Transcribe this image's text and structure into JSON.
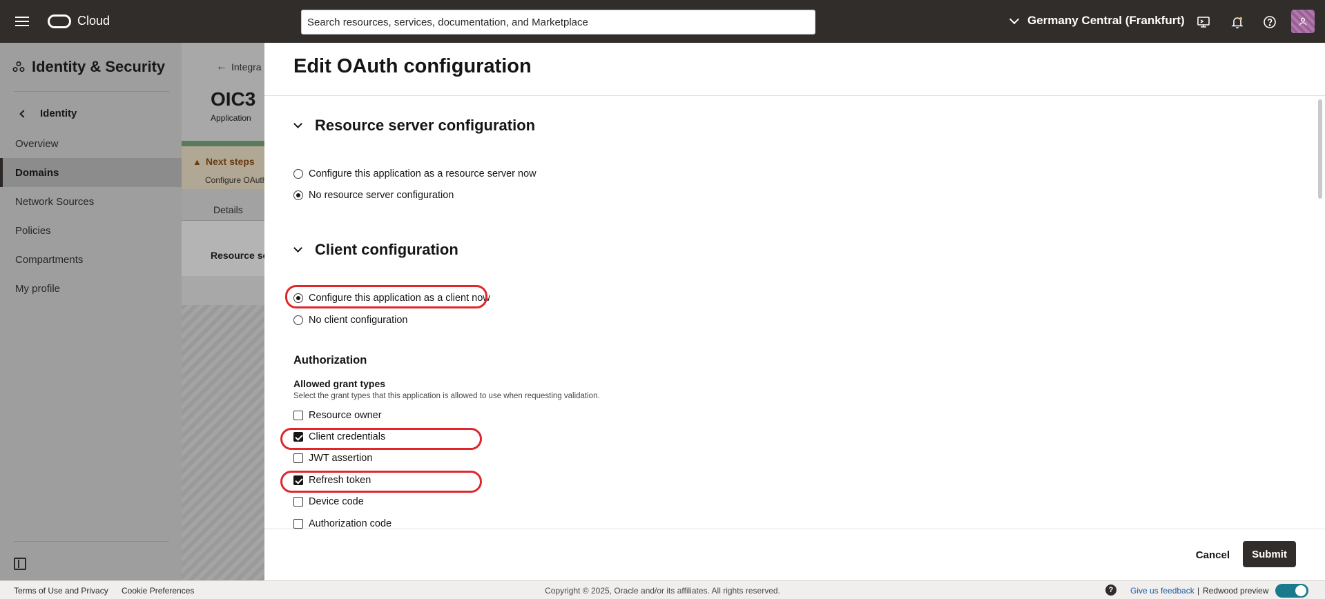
{
  "header": {
    "brand": "Cloud",
    "search_placeholder": "Search resources, services, documentation, and Marketplace",
    "region": "Germany Central (Frankfurt)"
  },
  "sidebar": {
    "title": "Identity & Security",
    "back_label": "Identity",
    "items": [
      {
        "label": "Overview"
      },
      {
        "label": "Domains"
      },
      {
        "label": "Network Sources"
      },
      {
        "label": "Policies"
      },
      {
        "label": "Compartments"
      },
      {
        "label": "My profile"
      }
    ]
  },
  "background_page": {
    "breadcrumb": "Integra",
    "title": "OIC3",
    "subtitle": "Application",
    "next_steps_title": "Next steps",
    "next_steps_text": "Configure OAuth",
    "tab": "Details",
    "section": "Resource se"
  },
  "drawer": {
    "title": "Edit OAuth configuration",
    "resource_server": {
      "heading": "Resource server configuration",
      "options": [
        {
          "label": "Configure this application as a resource server now",
          "selected": false
        },
        {
          "label": "No resource server configuration",
          "selected": true
        }
      ]
    },
    "client": {
      "heading": "Client configuration",
      "options": [
        {
          "label": "Configure this application as a client now",
          "selected": true
        },
        {
          "label": "No client configuration",
          "selected": false
        }
      ]
    },
    "authorization": {
      "heading": "Authorization",
      "grant_label": "Allowed grant types",
      "grant_help": "Select the grant types that this application is allowed to use when requesting validation.",
      "grants": [
        {
          "label": "Resource owner",
          "checked": false
        },
        {
          "label": "Client credentials",
          "checked": true
        },
        {
          "label": "JWT assertion",
          "checked": false
        },
        {
          "label": "Refresh token",
          "checked": true
        },
        {
          "label": "Device code",
          "checked": false
        },
        {
          "label": "Authorization code",
          "checked": false
        }
      ]
    },
    "cancel_label": "Cancel",
    "submit_label": "Submit"
  },
  "footer": {
    "terms": "Terms of Use and Privacy",
    "cookies": "Cookie Preferences",
    "copyright": "Copyright © 2025, Oracle and/or its affiliates. All rights reserved.",
    "feedback": "Give us feedback",
    "separator": "|",
    "preview": "Redwood preview"
  },
  "colors": {
    "topbar": "#312d2a",
    "highlight": "#e0262a",
    "toggle": "#1a7a8c"
  }
}
